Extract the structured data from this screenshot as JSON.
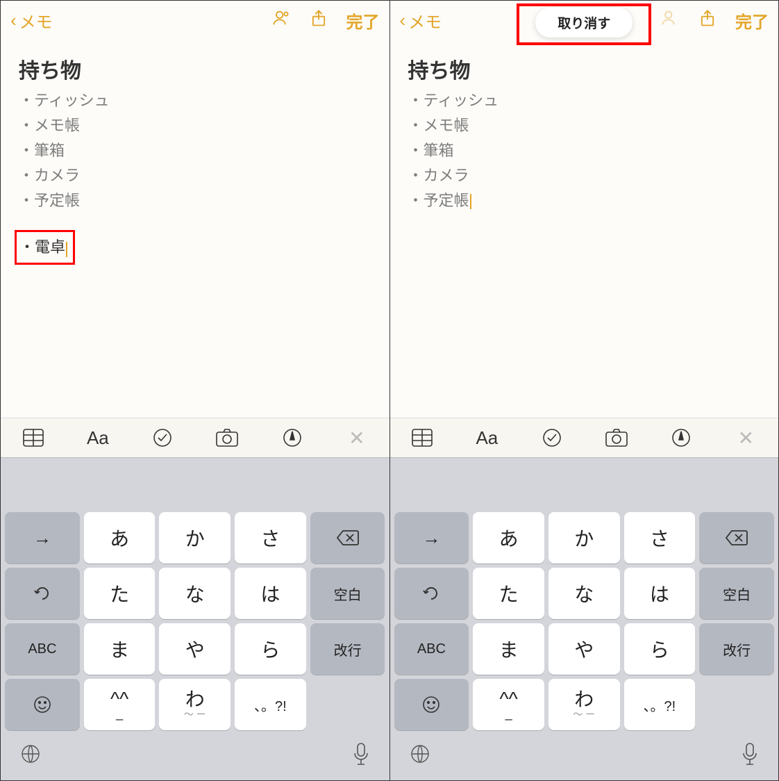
{
  "left": {
    "nav": {
      "back": "メモ",
      "done": "完了"
    },
    "title": "持ち物",
    "items": [
      "・ティッシュ",
      "・メモ帳",
      "・筆箱",
      "・カメラ",
      "・予定帳"
    ],
    "extra": "・電卓"
  },
  "right": {
    "nav": {
      "back": "メモ",
      "done": "完了"
    },
    "undo": "取り消す",
    "title": "持ち物",
    "items": [
      "・ティッシュ",
      "・メモ帳",
      "・筆箱",
      "・カメラ",
      "・予定帳"
    ]
  },
  "toolbar": {
    "aa": "Aa"
  },
  "keyboard": {
    "rows": [
      [
        "→",
        "あ",
        "か",
        "さ",
        "⌫"
      ],
      [
        "↺",
        "た",
        "な",
        "は",
        "空白"
      ],
      [
        "ABC",
        "ま",
        "や",
        "ら",
        "改行"
      ],
      [
        "☺",
        "^^",
        "わ",
        "、。?!",
        ""
      ]
    ],
    "arrow": "→",
    "undo": "↺",
    "abc": "ABC",
    "emoji": "☺",
    "a": "あ",
    "ka": "か",
    "sa": "さ",
    "ta": "た",
    "na": "な",
    "ha": "は",
    "ma": "ま",
    "ya": "や",
    "ra": "ら",
    "wa": "わ",
    "caret": "^^",
    "punct": "、。?!",
    "_": "_",
    "del": "⌫",
    "space": "空白",
    "enter": "改行"
  }
}
